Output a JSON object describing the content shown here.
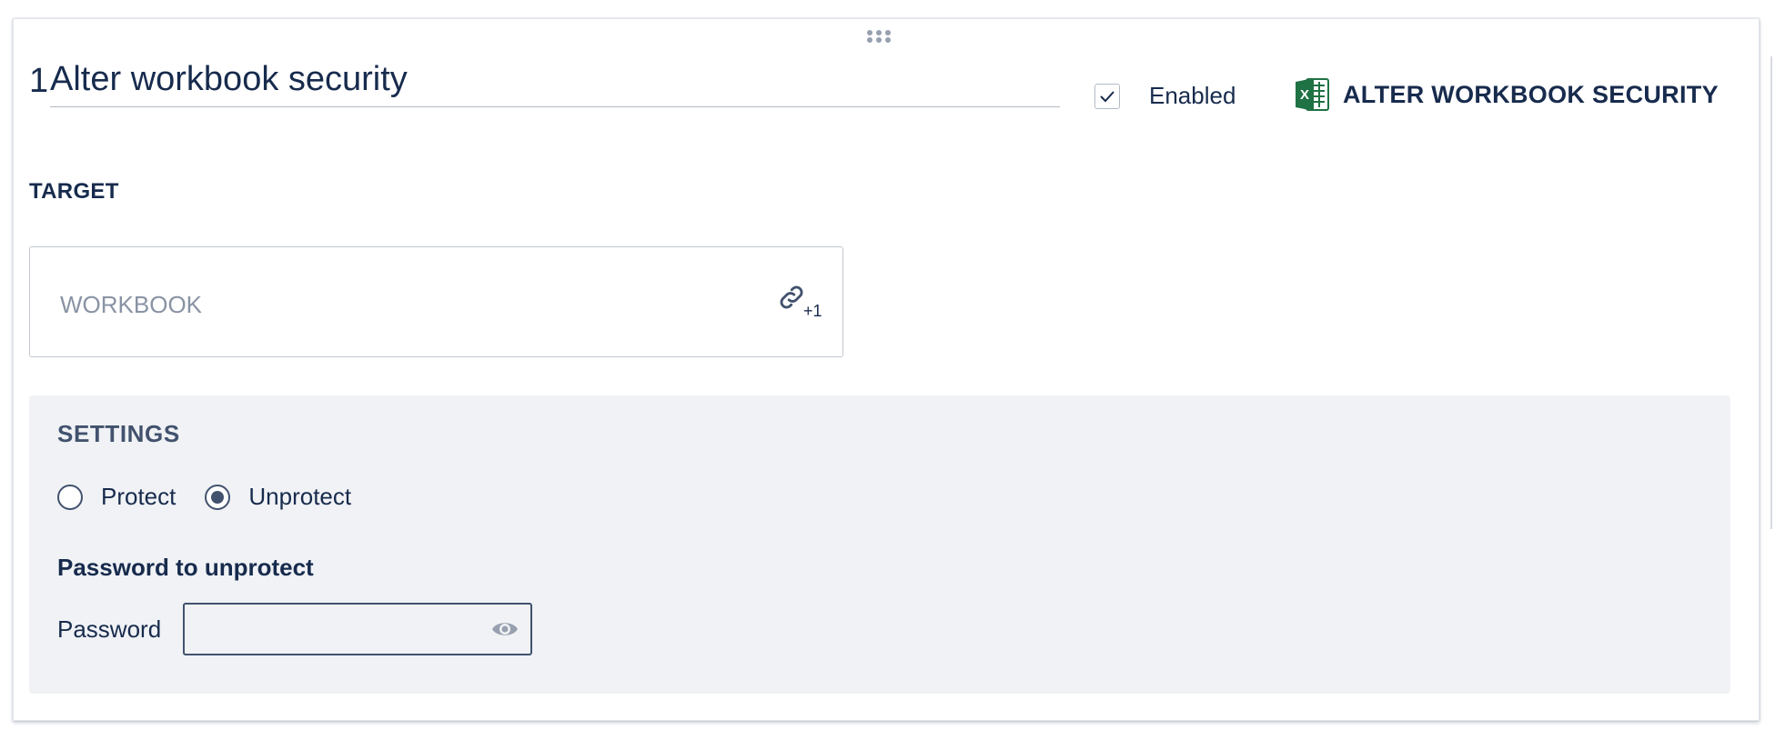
{
  "header": {
    "step_number": "1",
    "title": "Alter workbook security",
    "enabled_label": "Enabled",
    "enabled_checked": true,
    "action_type": "ALTER WORKBOOK SECURITY",
    "app_icon": "excel-icon",
    "drag_icon": "drag-handle-icon"
  },
  "target": {
    "label": "TARGET",
    "placeholder": "WORKBOOK",
    "link_icon": "link-icon",
    "link_count": "+1"
  },
  "settings": {
    "title": "SETTINGS",
    "options": [
      {
        "label": "Protect",
        "checked": false
      },
      {
        "label": "Unprotect",
        "checked": true
      }
    ],
    "password_heading": "Password to unprotect",
    "password_label": "Password",
    "password_value": "",
    "eye_icon": "eye-icon"
  },
  "colors": {
    "text": "#172b4d",
    "muted": "#8993a4",
    "settings_bg": "#f0f2f5",
    "excel_green": "#1f7244"
  }
}
